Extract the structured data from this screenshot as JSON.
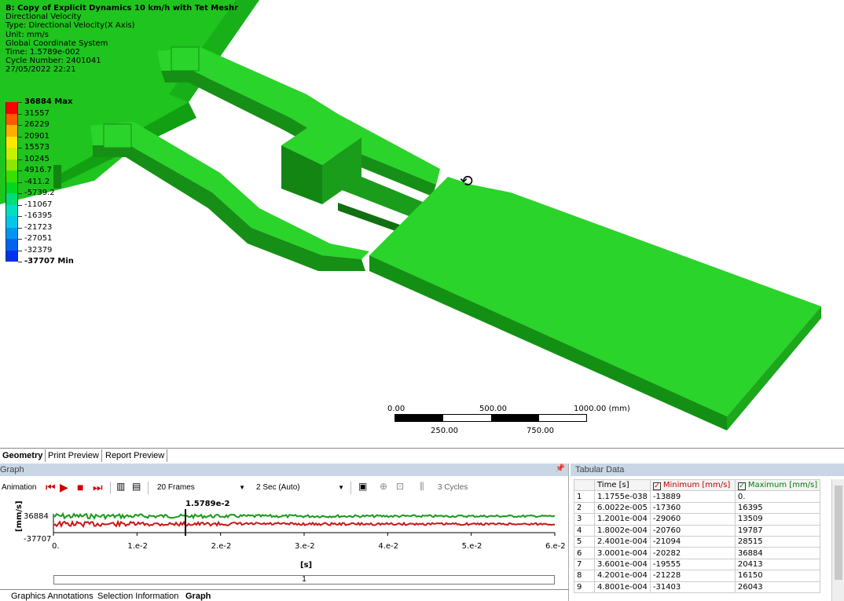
{
  "viewport": {
    "info": {
      "title": "B: Copy of Explicit Dynamics 10 km/h with Tet Meshr",
      "lines": [
        "Directional Velocity",
        "Type: Directional Velocity(X Axis)",
        "Unit: mm/s",
        "Global Coordinate System",
        "Time: 1.5789e-002",
        "Cycle Number: 2401041",
        "27/05/2022 22:21"
      ]
    },
    "legend": [
      {
        "label": "36884 Max",
        "color": "#ff0000"
      },
      {
        "label": "31557",
        "color": "#ff5a00"
      },
      {
        "label": "26229",
        "color": "#ffae00"
      },
      {
        "label": "20901",
        "color": "#ffe800"
      },
      {
        "label": "15573",
        "color": "#c8f000"
      },
      {
        "label": "10245",
        "color": "#8ce800"
      },
      {
        "label": "4916.7",
        "color": "#38e000"
      },
      {
        "label": "-411.2",
        "color": "#00d820"
      },
      {
        "label": "-5739.2",
        "color": "#00dc78"
      },
      {
        "label": "-11067",
        "color": "#00e0c0"
      },
      {
        "label": "-16395",
        "color": "#00c8e8"
      },
      {
        "label": "-21723",
        "color": "#0096f0"
      },
      {
        "label": "-27051",
        "color": "#0064f0"
      },
      {
        "label": "-32379",
        "color": "#0030f0"
      },
      {
        "label": "-37707 Min",
        "color": ""
      }
    ],
    "scale": {
      "t0": "0.00",
      "t1": "500.00",
      "t2": "1000.00 (mm)",
      "b1": "250.00",
      "b2": "750.00"
    }
  },
  "tabs": [
    "Geometry",
    "Print Preview",
    "Report Preview"
  ],
  "graph": {
    "title": "Graph",
    "toolbar": {
      "label": "Animation",
      "frames": "20 Frames",
      "duration": "2 Sec (Auto)",
      "cycles": "3 Cycles"
    },
    "plot": {
      "ylabel": "[mm/s]",
      "ymax": "36884",
      "ymin": "-37707",
      "marker": "1.5789e-2",
      "xticks": [
        "0.",
        "1.e-2",
        "2.e-2",
        "3.e-2",
        "4.e-2",
        "5.e-2",
        "6.e-2"
      ],
      "xlabel": "[s]"
    },
    "slider_label": "1",
    "bottom_tabs": [
      "Graphics Annotations",
      "Selection Information",
      "Graph"
    ]
  },
  "tabular": {
    "title": "Tabular Data",
    "headers": [
      "",
      "Time [s]",
      "Minimum [mm/s]",
      "Maximum [mm/s]"
    ],
    "colors": {
      "min": "#c00000",
      "max": "#008000"
    },
    "rows": [
      [
        "1",
        "1.1755e-038",
        "-13889",
        "0."
      ],
      [
        "2",
        "6.0022e-005",
        "-17360",
        "16395"
      ],
      [
        "3",
        "1.2001e-004",
        "-29060",
        "13509"
      ],
      [
        "4",
        "1.8002e-004",
        "-20760",
        "19787"
      ],
      [
        "5",
        "2.4001e-004",
        "-21094",
        "28515"
      ],
      [
        "6",
        "3.0001e-004",
        "-20282",
        "36884"
      ],
      [
        "7",
        "3.6001e-004",
        "-19555",
        "20413"
      ],
      [
        "8",
        "4.2001e-004",
        "-21228",
        "16150"
      ],
      [
        "9",
        "4.8001e-004",
        "-31403",
        "26043"
      ]
    ]
  }
}
